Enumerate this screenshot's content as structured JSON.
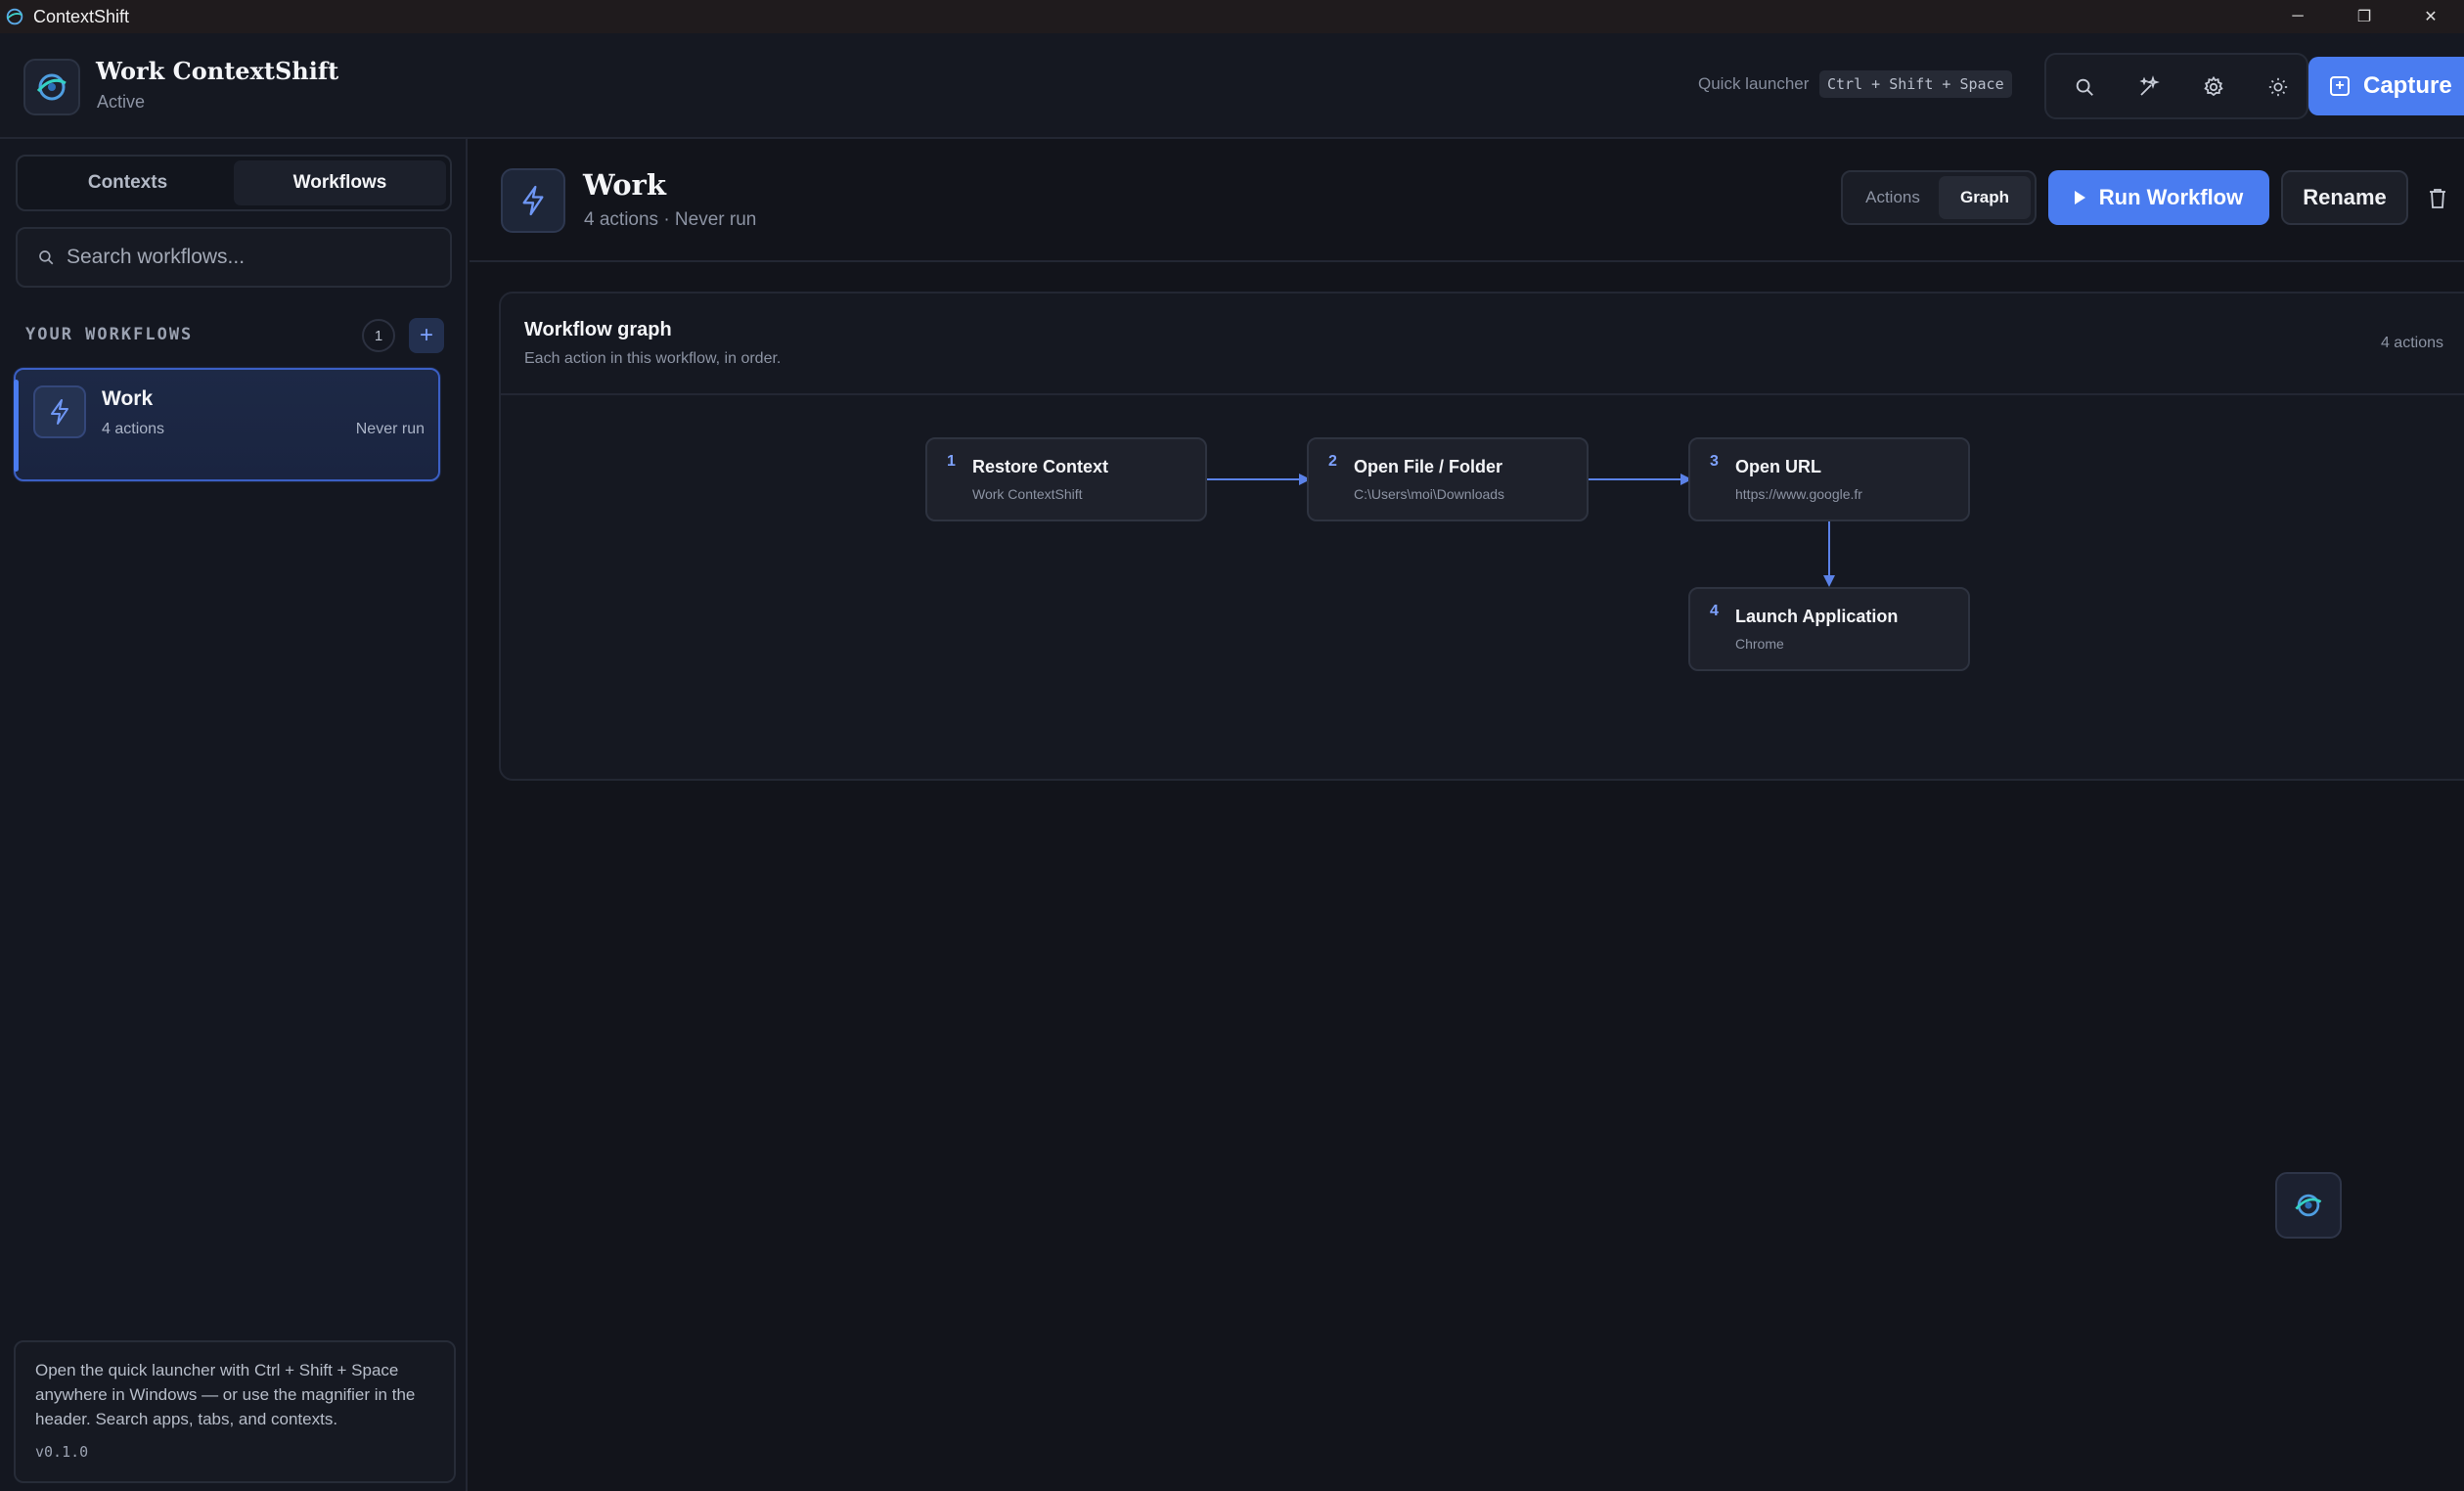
{
  "window": {
    "title": "ContextShift",
    "controls": {
      "minimize": "─",
      "restore": "❐",
      "close": "✕"
    }
  },
  "header": {
    "brand_name": "Work ContextShift",
    "status": "Active",
    "quick_launcher_label": "Quick launcher",
    "quick_launcher_shortcut": "Ctrl + Shift + Space",
    "tools": [
      "search-icon",
      "sparkles-icon",
      "gear-icon",
      "sun-icon"
    ],
    "capture_label": "Capture"
  },
  "sidebar": {
    "tabs": [
      {
        "label": "Contexts",
        "active": false
      },
      {
        "label": "Workflows",
        "active": true
      }
    ],
    "search_placeholder": "Search workflows...",
    "section_title": "YOUR WORKFLOWS",
    "count": "1",
    "workflows": [
      {
        "name": "Work",
        "actions": "4 actions",
        "last_run": "Never run",
        "selected": true
      }
    ],
    "tip": "Open the quick launcher with Ctrl + Shift + Space anywhere in Windows — or use the magnifier in the header. Search apps, tabs, and contexts.",
    "version": "v0.1.0"
  },
  "main": {
    "title": "Work",
    "subtitle": "4 actions · Never run",
    "view_tabs": [
      {
        "label": "Actions",
        "active": false
      },
      {
        "label": "Graph",
        "active": true
      }
    ],
    "run_label": "Run Workflow",
    "rename_label": "Rename",
    "graph": {
      "title": "Workflow graph",
      "subtitle": "Each action in this workflow, in order.",
      "count_label": "4 actions",
      "nodes": [
        {
          "num": "1",
          "title": "Restore Context",
          "detail": "Work ContextShift"
        },
        {
          "num": "2",
          "title": "Open File / Folder",
          "detail": "C:\\Users\\moi\\Downloads"
        },
        {
          "num": "3",
          "title": "Open URL",
          "detail": "https://www.google.fr"
        },
        {
          "num": "4",
          "title": "Launch Application",
          "detail": "Chrome"
        }
      ]
    }
  },
  "colors": {
    "accent": "#4a7cf0",
    "background": "#12141b",
    "panel": "#151821"
  }
}
